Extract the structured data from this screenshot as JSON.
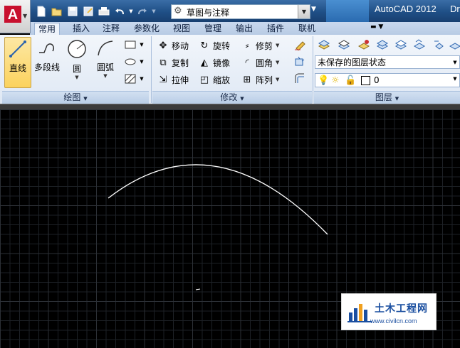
{
  "title_bar": {
    "app_title": "AutoCAD 2012",
    "doc_title_fragment": "Dr",
    "workspace": "草图与注释"
  },
  "qat": {
    "icons": [
      "new-icon",
      "open-icon",
      "save-icon",
      "save-as-icon",
      "print-icon",
      "undo-icon",
      "redo-icon"
    ]
  },
  "tabs": [
    {
      "label": "常用",
      "active": true
    },
    {
      "label": "插入",
      "active": false
    },
    {
      "label": "注释",
      "active": false
    },
    {
      "label": "参数化",
      "active": false
    },
    {
      "label": "视图",
      "active": false
    },
    {
      "label": "管理",
      "active": false
    },
    {
      "label": "输出",
      "active": false
    },
    {
      "label": "插件",
      "active": false
    },
    {
      "label": "联机",
      "active": false
    }
  ],
  "draw_panel": {
    "title": "绘图",
    "line": "直线",
    "polyline": "多段线",
    "circle": "圆",
    "arc": "圆弧"
  },
  "modify_panel": {
    "title": "修改",
    "move": "移动",
    "rotate": "旋转",
    "trim": "修剪",
    "copy": "复制",
    "mirror": "镜像",
    "fillet": "圆角",
    "stretch": "拉伸",
    "scale": "缩放",
    "array": "阵列"
  },
  "layers_panel": {
    "title": "图层",
    "layer_state": "未保存的图层状态",
    "current_layer": "0"
  },
  "watermark": {
    "name": "土木工程网",
    "url": "www.civilcn.com"
  },
  "colors": {
    "title_bar": "#1f4f86",
    "ribbon": "#e6edf7",
    "active_tool": "#fbd25d",
    "canvas": "#000000",
    "drawn_entity": "#ffffff",
    "watermark_text": "#1b4fa0"
  }
}
